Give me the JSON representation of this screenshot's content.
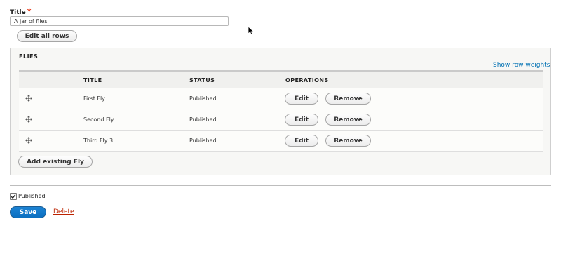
{
  "title_field": {
    "label": "Title",
    "required_marker": "*",
    "value": "A jar of flies"
  },
  "edit_all_rows_label": "Edit all rows",
  "flies": {
    "legend": "FLIES",
    "show_row_weights": "Show row weights",
    "columns": {
      "title": "TITLE",
      "status": "STATUS",
      "operations": "OPERATIONS"
    },
    "rows": [
      {
        "title": "First Fly",
        "status": "Published",
        "edit": "Edit",
        "remove": "Remove"
      },
      {
        "title": "Second Fly",
        "status": "Published",
        "edit": "Edit",
        "remove": "Remove"
      },
      {
        "title": "Third Fly 3",
        "status": "Published",
        "edit": "Edit",
        "remove": "Remove"
      }
    ],
    "add_existing_label": "Add existing Fly"
  },
  "published": {
    "label": "Published",
    "checked": true
  },
  "actions": {
    "save_label": "Save",
    "delete_label": "Delete"
  },
  "colors": {
    "primary": "#0071b3",
    "danger": "#bc2300",
    "required": "#e62600"
  },
  "icons": {
    "drag": "drag-handle-icon",
    "cursor": "mouse-cursor-icon",
    "checkbox": "checkmark-icon"
  }
}
